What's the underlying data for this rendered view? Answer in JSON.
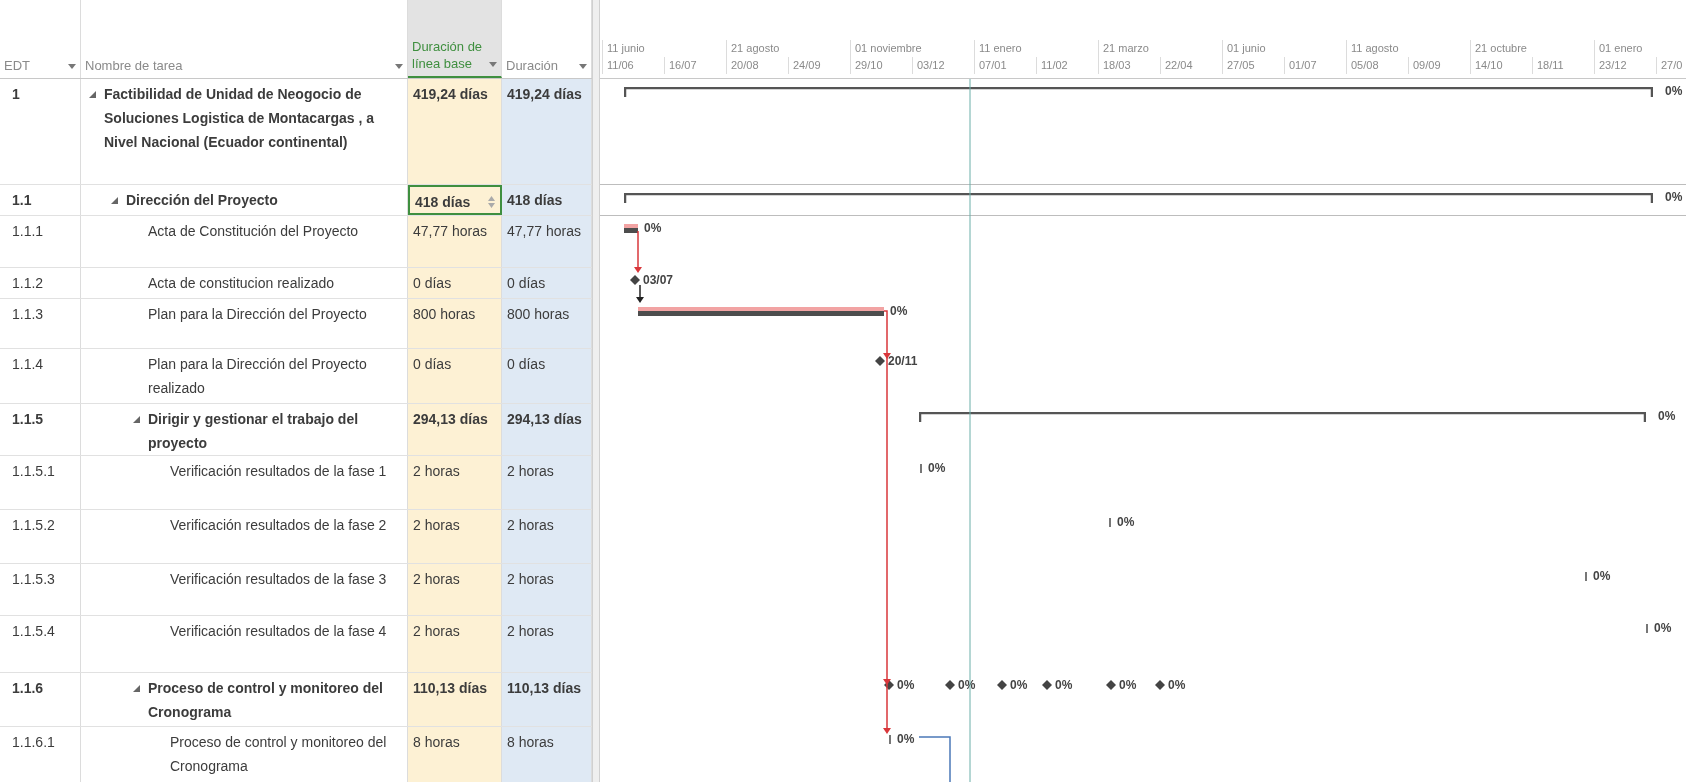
{
  "table": {
    "columns": [
      {
        "label": "EDT",
        "selected": false
      },
      {
        "label": "Nombre de tarea",
        "selected": false
      },
      {
        "label": "Duración de línea base",
        "selected": true
      },
      {
        "label": "Duración",
        "selected": false
      }
    ]
  },
  "timeline": {
    "major": [
      "11 junio",
      "21 agosto",
      "01 noviembre",
      "11 enero",
      "21 marzo",
      "01 junio",
      "11 agosto",
      "21 octubre",
      "01 enero"
    ],
    "minor": [
      "11/06",
      "16/07",
      "20/08",
      "24/09",
      "29/10",
      "03/12",
      "07/01",
      "11/02",
      "18/03",
      "22/04",
      "27/05",
      "01/07",
      "05/08",
      "09/09",
      "14/10",
      "18/11",
      "23/12",
      "27/0"
    ]
  },
  "tasks": [
    {
      "wbs": "1",
      "name": "Factibilidad de Unidad de Neogocio de Soluciones Logistica de Montacargas , a Nivel Nacional (Ecuador continental)",
      "expanded": true,
      "baseline": "419,24 días",
      "duration": "419,24 días",
      "selected": false,
      "gantt": [
        {
          "kind": "summary",
          "label": "0%"
        }
      ],
      "children": [
        {
          "wbs": "1.1",
          "name": "Dirección del Proyecto",
          "expanded": true,
          "baseline": "418 días",
          "duration": "418 días",
          "selected": true,
          "gantt": [
            {
              "kind": "summary",
              "label": "0%"
            }
          ],
          "children": [
            {
              "wbs": "1.1.1",
              "name": "Acta de Constitución del Proyecto",
              "baseline": "47,77 horas",
              "duration": "47,77 horas",
              "selected": false,
              "gantt": [
                {
                  "kind": "task",
                  "label": "0%"
                }
              ]
            },
            {
              "wbs": "1.1.2",
              "name": "Acta de constitucion realizado",
              "baseline": "0 días",
              "duration": "0 días",
              "selected": false,
              "gantt": [
                {
                  "kind": "milestone",
                  "label": "03/07"
                }
              ]
            },
            {
              "wbs": "1.1.3",
              "name": "Plan para la Dirección del Proyecto",
              "baseline": "800 horas",
              "duration": "800 horas",
              "selected": false,
              "gantt": [
                {
                  "kind": "task",
                  "label": "0%"
                }
              ]
            },
            {
              "wbs": "1.1.4",
              "name": "Plan para la Dirección del Proyecto realizado",
              "baseline": "0 días",
              "duration": "0 días",
              "selected": false,
              "gantt": [
                {
                  "kind": "milestone",
                  "label": "20/11"
                }
              ]
            },
            {
              "wbs": "1.1.5",
              "name": "Dirigir y gestionar el trabajo del proyecto",
              "expanded": true,
              "baseline": "294,13 días",
              "duration": "294,13 días",
              "selected": false,
              "gantt": [
                {
                  "kind": "summary",
                  "label": "0%"
                }
              ],
              "children": [
                {
                  "wbs": "1.1.5.1",
                  "name": "Verificación resultados de la fase 1",
                  "baseline": "2 horas",
                  "duration": "2 horas",
                  "selected": false,
                  "gantt": [
                    {
                      "kind": "tick",
                      "label": "0%"
                    }
                  ]
                },
                {
                  "wbs": "1.1.5.2",
                  "name": "Verificación resultados de la fase 2",
                  "baseline": "2 horas",
                  "duration": "2 horas",
                  "selected": false,
                  "gantt": [
                    {
                      "kind": "tick",
                      "label": "0%"
                    }
                  ]
                },
                {
                  "wbs": "1.1.5.3",
                  "name": "Verificación resultados de la fase 3",
                  "baseline": "2 horas",
                  "duration": "2 horas",
                  "selected": false,
                  "gantt": [
                    {
                      "kind": "tick",
                      "label": "0%"
                    }
                  ]
                },
                {
                  "wbs": "1.1.5.4",
                  "name": "Verificación resultados de la fase 4",
                  "baseline": "2 horas",
                  "duration": "2 horas",
                  "selected": false,
                  "gantt": [
                    {
                      "kind": "tick",
                      "label": "0%"
                    }
                  ]
                }
              ]
            },
            {
              "wbs": "1.1.6",
              "name": "Proceso de control y monitoreo del Cronograma",
              "expanded": true,
              "baseline": "110,13 días",
              "duration": "110,13 días",
              "selected": false,
              "gantt": [
                {
                  "kind": "milestone",
                  "label": "0%"
                },
                {
                  "kind": "milestone",
                  "label": "0%"
                },
                {
                  "kind": "milestone",
                  "label": "0%"
                },
                {
                  "kind": "milestone",
                  "label": "0%"
                },
                {
                  "kind": "milestone",
                  "label": "0%"
                },
                {
                  "kind": "milestone",
                  "label": "0%"
                }
              ],
              "children": [
                {
                  "wbs": "1.1.6.1",
                  "name": "Proceso de control y monitoreo del Cronograma",
                  "baseline": "8 horas",
                  "duration": "8 horas",
                  "selected": false,
                  "gantt": [
                    {
                      "kind": "tick",
                      "label": "0%"
                    }
                  ]
                }
              ]
            }
          ]
        }
      ]
    }
  ]
}
